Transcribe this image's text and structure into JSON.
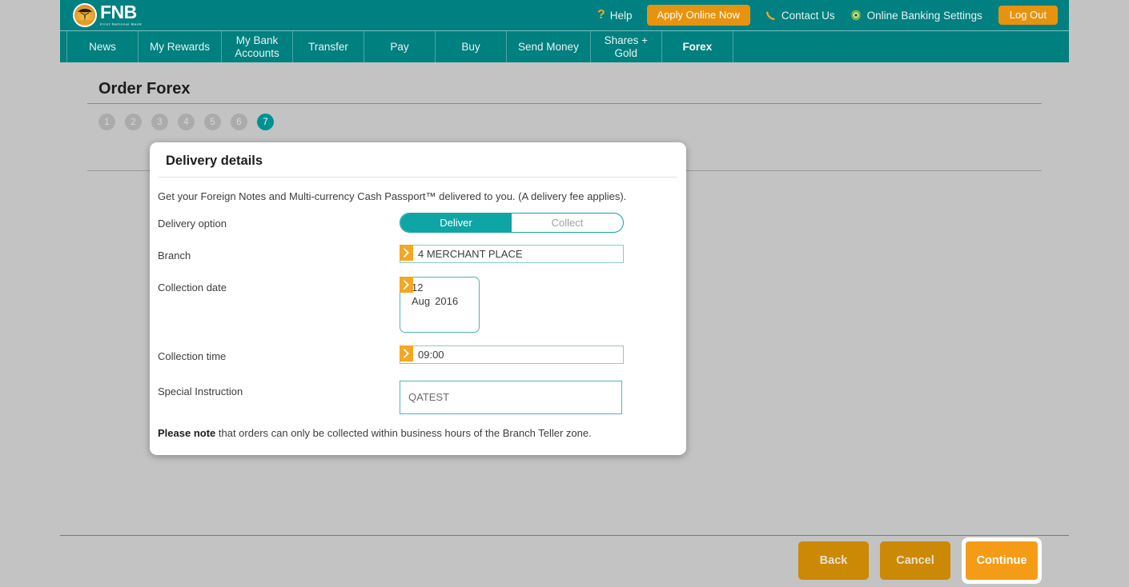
{
  "theme": {
    "teal": "#008080",
    "teal_light": "#0fa5a5",
    "orange": "#e8930f",
    "orange_bright": "#f59c17",
    "orange_dark": "#cb8905",
    "page_bg": "#c3c3c3"
  },
  "header": {
    "logo": {
      "name": "FNB",
      "subtitle": "First National Bank"
    },
    "help_label": "Help",
    "apply_label": "Apply Online Now",
    "contact_label": "Contact Us",
    "settings_label": "Online Banking Settings",
    "logout_label": "Log Out"
  },
  "nav": {
    "items": [
      {
        "label": "News",
        "active": false
      },
      {
        "label": "My Rewards",
        "active": false
      },
      {
        "label": "My Bank\nAccounts",
        "active": false
      },
      {
        "label": "Transfer",
        "active": false
      },
      {
        "label": "Pay",
        "active": false
      },
      {
        "label": "Buy",
        "active": false
      },
      {
        "label": "Send Money",
        "active": false
      },
      {
        "label": "Shares +\nGold",
        "active": false
      },
      {
        "label": "Forex",
        "active": true
      }
    ]
  },
  "page": {
    "title": "Order Forex",
    "steps": [
      "1",
      "2",
      "3",
      "4",
      "5",
      "6",
      "7"
    ],
    "current_step": "7"
  },
  "card": {
    "title": "Delivery details",
    "intro": "Get your Foreign Notes and Multi-currency Cash Passport™ delivered to you. (A delivery fee applies).",
    "fields": {
      "delivery_option": {
        "label": "Delivery option",
        "options": [
          "Deliver",
          "Collect"
        ],
        "selected": "Deliver"
      },
      "branch": {
        "label": "Branch",
        "value": "4 MERCHANT PLACE"
      },
      "collection_date": {
        "label": "Collection date",
        "day": "12",
        "month": "Aug",
        "year": "2016"
      },
      "collection_time": {
        "label": "Collection time",
        "value": "09:00"
      },
      "special_instruction": {
        "label": "Special Instruction",
        "value": "QATEST"
      }
    },
    "note_bold": "Please note",
    "note_rest": " that orders can only be collected within business hours of the Branch Teller zone."
  },
  "footer": {
    "back_label": "Back",
    "cancel_label": "Cancel",
    "continue_label": "Continue"
  }
}
